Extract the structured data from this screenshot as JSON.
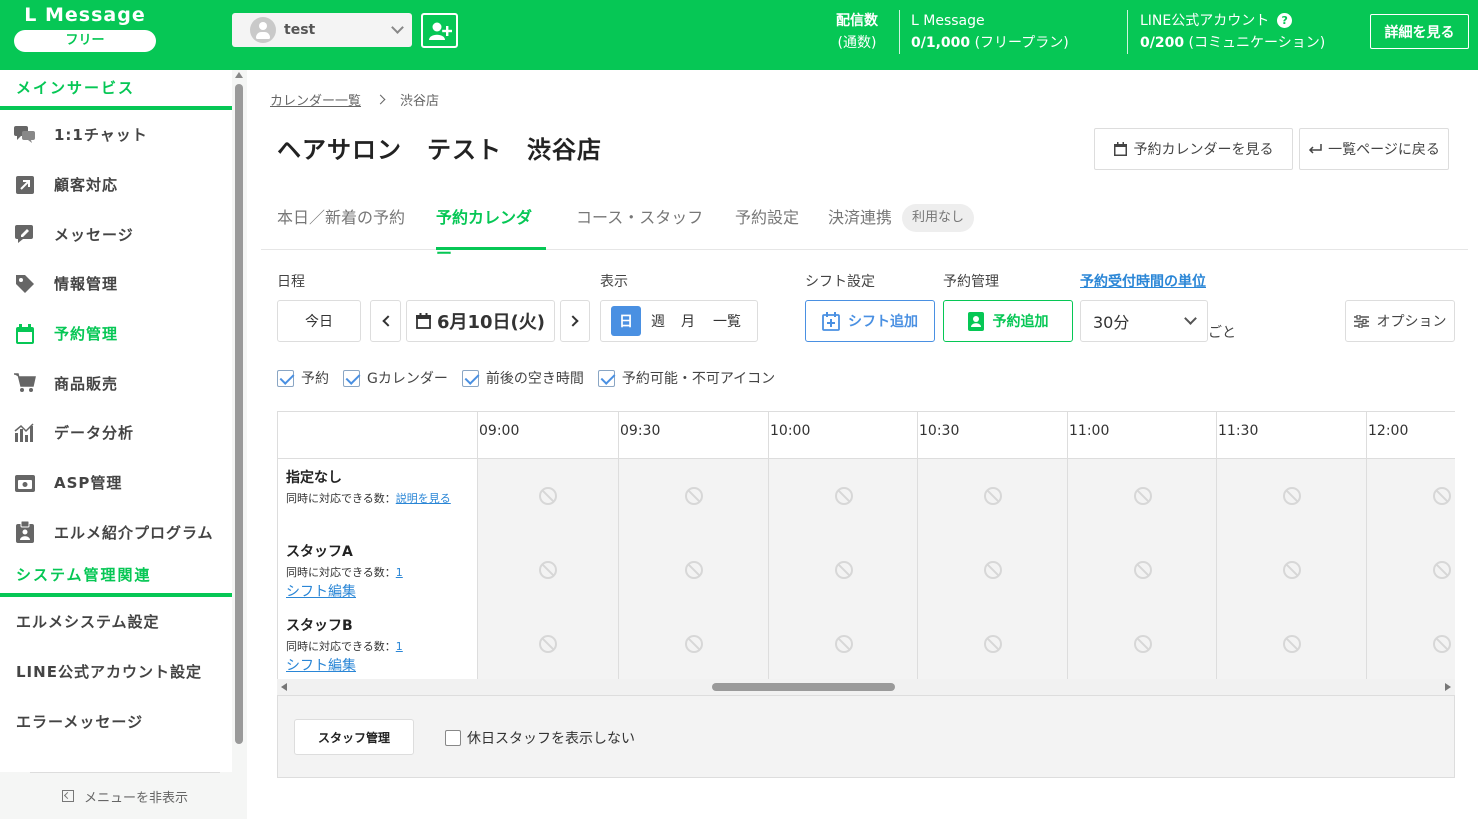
{
  "header": {
    "logo_title": "L Message",
    "logo_plan": "フリー",
    "account_name": "test",
    "stats": {
      "delivery_label": "配信数",
      "delivery_sub": "(通数)",
      "lmessage_label": "L Message",
      "lmessage_value": "0/1,000",
      "lmessage_plan": "(フリープラン)",
      "line_label": "LINE公式アカウント",
      "line_value": "0/200",
      "line_plan": "(コミュニケーション)"
    },
    "detail_button": "詳細を見る"
  },
  "sidebar": {
    "section_main": "メインサービス",
    "items": [
      {
        "label": "1:1チャット",
        "icon": "chat-icon"
      },
      {
        "label": "顧客対応",
        "icon": "arrow-box-icon"
      },
      {
        "label": "メッセージ",
        "icon": "message-edit-icon"
      },
      {
        "label": "情報管理",
        "icon": "tag-icon"
      },
      {
        "label": "予約管理",
        "icon": "calendar-icon"
      },
      {
        "label": "商品販売",
        "icon": "cart-icon"
      },
      {
        "label": "データ分析",
        "icon": "bar-chart-icon"
      },
      {
        "label": "ASP管理",
        "icon": "asp-icon"
      },
      {
        "label": "エルメ紹介プログラム",
        "icon": "clipboard-icon"
      }
    ],
    "section_system": "システム管理関連",
    "system_items": [
      "エルメシステム設定",
      "LINE公式アカウント設定",
      "エラーメッセージ"
    ],
    "hide_menu": "メニューを非表示"
  },
  "breadcrumb": {
    "parent": "カレンダー一覧",
    "current": "渋谷店"
  },
  "page_title": "ヘアサロン　テスト　渋谷店",
  "actions": {
    "view_calendar": "予約カレンダーを見る",
    "back_to_list": "一覧ページに戻る"
  },
  "tabs": [
    {
      "label": "本日／新着の予約"
    },
    {
      "label": "予約カレンダー"
    },
    {
      "label": "コース・スタッフ"
    },
    {
      "label": "予約設定"
    },
    {
      "label": "決済連携"
    }
  ],
  "tab_badge": "利用なし",
  "controls": {
    "schedule_label": "日程",
    "today": "今日",
    "date": "6月10日(火)",
    "display_label": "表示",
    "views": [
      "日",
      "週",
      "月",
      "一覧"
    ],
    "shift_label": "シフト設定",
    "shift_add": "シフト追加",
    "reservation_label": "予約管理",
    "reservation_add": "予約追加",
    "unit_label": "予約受付時間の単位",
    "unit_value": "30分",
    "unit_suffix": "ごと",
    "options": "オプション"
  },
  "filters": [
    "予約",
    "Gカレンダー",
    "前後の空き時間",
    "予約可能・不可アイコン"
  ],
  "grid": {
    "times": [
      "09:00",
      "09:30",
      "10:00",
      "10:30",
      "11:00",
      "11:30",
      "12:00"
    ],
    "rows": [
      {
        "name": "指定なし",
        "capacity_label": "同時に対応できる数：",
        "capacity_value": "説明を見る",
        "link": ""
      },
      {
        "name": "スタッフA",
        "capacity_label": "同時に対応できる数：",
        "capacity_value": "1",
        "link": "シフト編集"
      },
      {
        "name": "スタッフB",
        "capacity_label": "同時に対応できる数：",
        "capacity_value": "1",
        "link": "シフト編集"
      }
    ]
  },
  "footer": {
    "staff_manage": "スタッフ管理",
    "hide_holiday": "休日スタッフを表示しない"
  },
  "colors": {
    "brand": "#06c755",
    "accent_blue": "#4a90e2"
  }
}
